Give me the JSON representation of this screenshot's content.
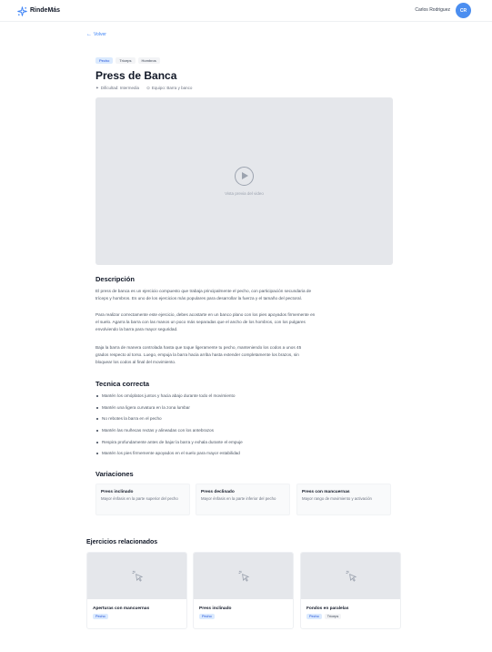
{
  "brand": {
    "name": "RindeMás"
  },
  "user": {
    "name": "Carlos Rodriguez",
    "initials": "CR"
  },
  "nav": {
    "back_label": "Volver"
  },
  "exercise": {
    "tags": [
      "Pecho",
      "Tríceps",
      "Hombros"
    ],
    "title": "Press de Banca",
    "difficulty": "Dificultad: Intermedia",
    "equipment": "Equipo: Barra y banco",
    "video_placeholder": "Vista previa del video"
  },
  "description": {
    "heading": "Descripción",
    "paragraphs": [
      [
        "El press de banca es un ejercicio compuesto que trabaja principalmente el pecho, con participación secundaria de",
        "tríceps y hombros. Es uno de los ejercicios más populares para desarrollar la fuerza y el tamaño del pectoral."
      ],
      [
        "Para realizar correctamente este ejercicio, debes acostarte en un banco plano con los pies apoyados firmemente en",
        "el suelo. Agarra la barra con las manos un poco más separadas que el ancho de los hombros, con los pulgares",
        "envolviendo la barra para mayor seguridad."
      ],
      [
        "Baja la barra de manera controlada hasta que toque ligeramente tu pecho, manteniendo los codos a unos 45",
        "grados respecto al torso. Luego, empuja la barra hacia arriba hasta extender completamente los brazos, sin",
        "bloquear los codos al final del movimiento."
      ]
    ]
  },
  "technique": {
    "heading": "Tecnica correcta",
    "items": [
      "Mantén los omóplatos juntos y hacia abajo durante todo el movimiento",
      "Mantén una ligera curvatura en la zona lumbar",
      "No rebotes la barra en el pecho",
      "Mantén las muñecas rectas y alineadas con los antebrazos",
      "Respira profundamente antes de bajar la barra y exhala durante el empuje",
      "Mantén los pies firmemente apoyados en el suelo para mayor estabilidad"
    ]
  },
  "variations": {
    "heading": "Variaciones",
    "items": [
      {
        "title": "Press inclinado",
        "desc": "Mayor énfasis en la parte superior del pecho"
      },
      {
        "title": "Press declinado",
        "desc": "Mayor énfasis en la parte inferior del pecho"
      },
      {
        "title": "Press con mancuernas",
        "desc": "Mayor rango de movimiento y activación"
      }
    ]
  },
  "related": {
    "heading": "Ejercicios relacionados",
    "items": [
      {
        "name": "Aperturas con mancuernas",
        "tags": [
          "Pecho"
        ]
      },
      {
        "name": "Press inclinado",
        "tags": [
          "Pecho"
        ]
      },
      {
        "name": "Fondos en paralelas",
        "tags": [
          "Pecho",
          "Tríceps"
        ]
      }
    ]
  },
  "colors": {
    "accent": "#3b82f6",
    "avatar_bg": "#4b8ef0",
    "placeholder_bg": "#e5e7eb"
  }
}
